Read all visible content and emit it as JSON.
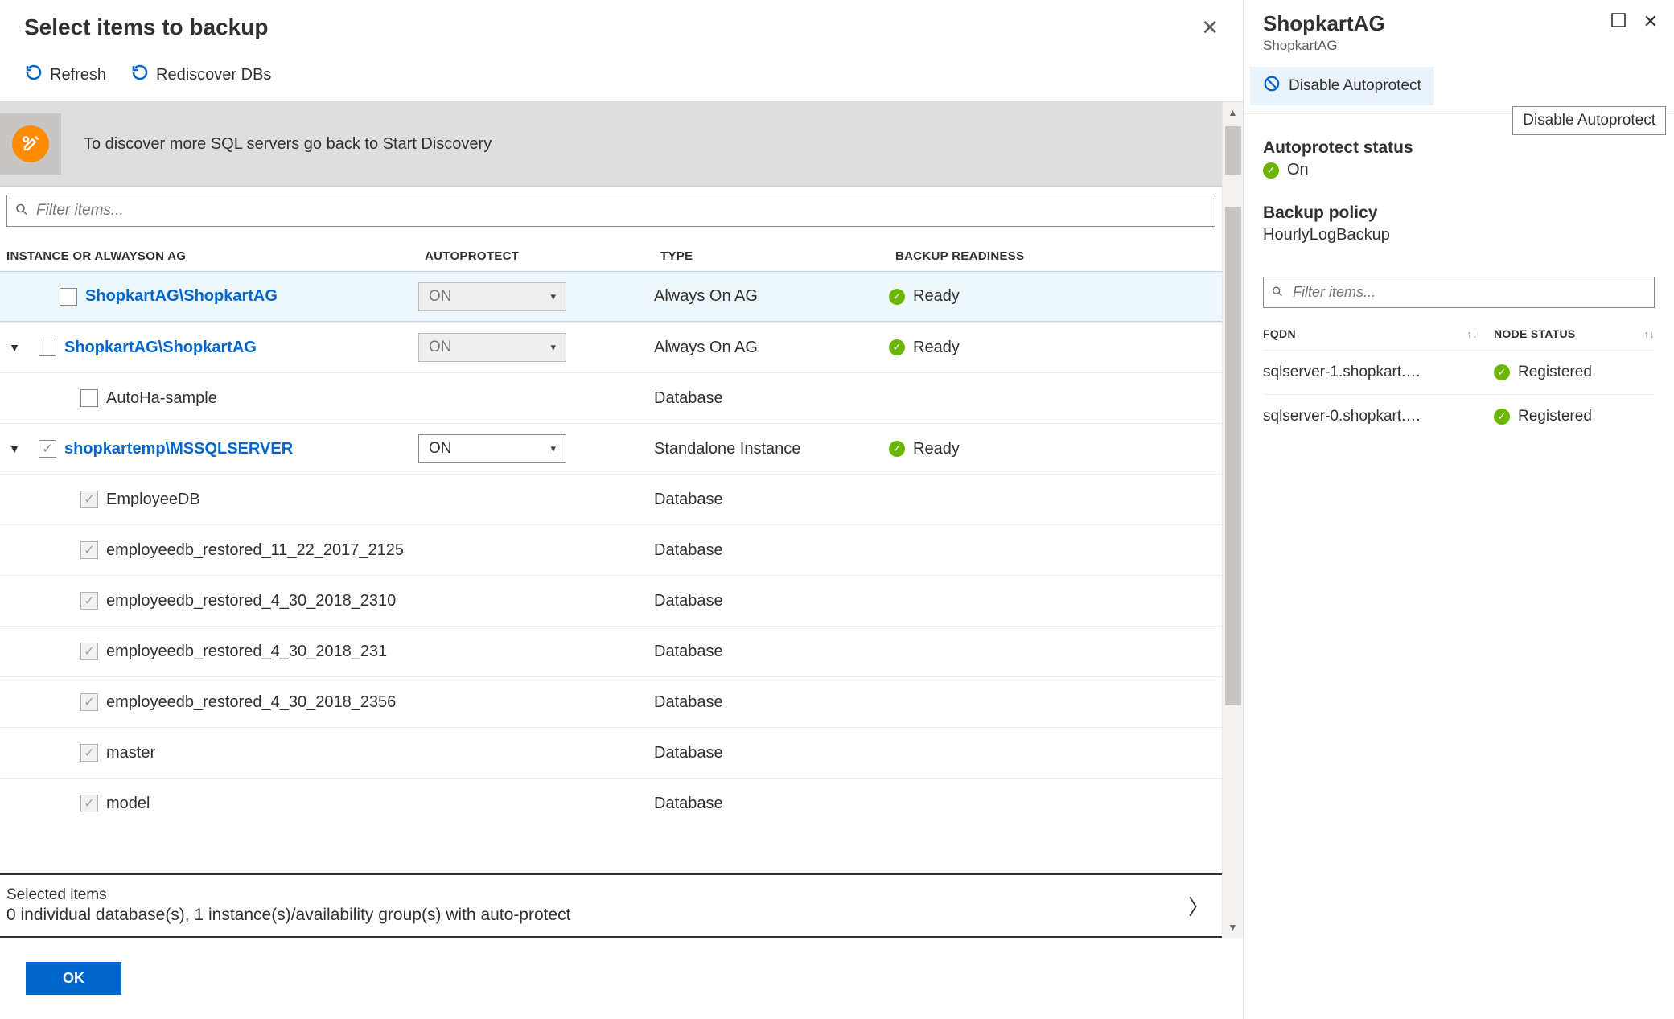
{
  "left": {
    "title": "Select items to backup",
    "toolbar": {
      "refresh": "Refresh",
      "rediscover": "Rediscover DBs"
    },
    "info": "To discover more SQL servers go back to Start Discovery",
    "filter_placeholder": "Filter items...",
    "columns": {
      "c1": "INSTANCE OR ALWAYSON AG",
      "c2": "AUTOPROTECT",
      "c3": "TYPE",
      "c4": "BACKUP READINESS"
    },
    "rows": [
      {
        "expander": "",
        "indent": 1,
        "checked": false,
        "chkDisabled": false,
        "link": true,
        "label": "ShopkartAG\\ShopkartAG",
        "ap": "ON",
        "apDisabled": true,
        "type": "Always On AG",
        "ready": "Ready",
        "selected": true
      },
      {
        "expander": "▼",
        "indent": 0,
        "checked": false,
        "chkDisabled": false,
        "link": true,
        "label": "ShopkartAG\\ShopkartAG",
        "ap": "ON",
        "apDisabled": true,
        "type": "Always On AG",
        "ready": "Ready",
        "selected": false
      },
      {
        "expander": "",
        "indent": 2,
        "checked": false,
        "chkDisabled": false,
        "link": false,
        "label": "AutoHa-sample",
        "ap": "",
        "apDisabled": false,
        "type": "Database",
        "ready": "",
        "selected": false
      },
      {
        "expander": "▼",
        "indent": 0,
        "checked": true,
        "chkDisabled": false,
        "link": true,
        "label": "shopkartemp\\MSSQLSERVER",
        "ap": "ON",
        "apDisabled": false,
        "type": "Standalone Instance",
        "ready": "Ready",
        "selected": false
      },
      {
        "expander": "",
        "indent": 2,
        "checked": true,
        "chkDisabled": true,
        "link": false,
        "label": "EmployeeDB",
        "ap": "",
        "apDisabled": false,
        "type": "Database",
        "ready": "",
        "selected": false
      },
      {
        "expander": "",
        "indent": 2,
        "checked": true,
        "chkDisabled": true,
        "link": false,
        "label": "employeedb_restored_11_22_2017_2125",
        "ap": "",
        "apDisabled": false,
        "type": "Database",
        "ready": "",
        "selected": false
      },
      {
        "expander": "",
        "indent": 2,
        "checked": true,
        "chkDisabled": true,
        "link": false,
        "label": "employeedb_restored_4_30_2018_2310",
        "ap": "",
        "apDisabled": false,
        "type": "Database",
        "ready": "",
        "selected": false
      },
      {
        "expander": "",
        "indent": 2,
        "checked": true,
        "chkDisabled": true,
        "link": false,
        "label": "employeedb_restored_4_30_2018_231",
        "ap": "",
        "apDisabled": false,
        "type": "Database",
        "ready": "",
        "selected": false
      },
      {
        "expander": "",
        "indent": 2,
        "checked": true,
        "chkDisabled": true,
        "link": false,
        "label": "employeedb_restored_4_30_2018_2356",
        "ap": "",
        "apDisabled": false,
        "type": "Database",
        "ready": "",
        "selected": false
      },
      {
        "expander": "",
        "indent": 2,
        "checked": true,
        "chkDisabled": true,
        "link": false,
        "label": "master",
        "ap": "",
        "apDisabled": false,
        "type": "Database",
        "ready": "",
        "selected": false
      },
      {
        "expander": "",
        "indent": 2,
        "checked": true,
        "chkDisabled": true,
        "link": false,
        "label": "model",
        "ap": "",
        "apDisabled": false,
        "type": "Database",
        "ready": "",
        "selected": false
      }
    ],
    "footer": {
      "line1": "Selected items",
      "line2": "0 individual database(s), 1 instance(s)/availability group(s) with auto-protect"
    },
    "ok": "OK"
  },
  "right": {
    "title": "ShopkartAG",
    "subtitle": "ShopkartAG",
    "disable": "Disable Autoprotect",
    "tooltip": "Disable Autoprotect",
    "status_label": "Autoprotect status",
    "status_value": "On",
    "policy_label": "Backup policy",
    "policy_value": "HourlyLogBackup",
    "filter_placeholder": "Filter items...",
    "columns": {
      "c1": "FQDN",
      "c2": "NODE STATUS"
    },
    "rows": [
      {
        "fqdn": "sqlserver-1.shopkart.…",
        "status": "Registered"
      },
      {
        "fqdn": "sqlserver-0.shopkart.…",
        "status": "Registered"
      }
    ]
  }
}
